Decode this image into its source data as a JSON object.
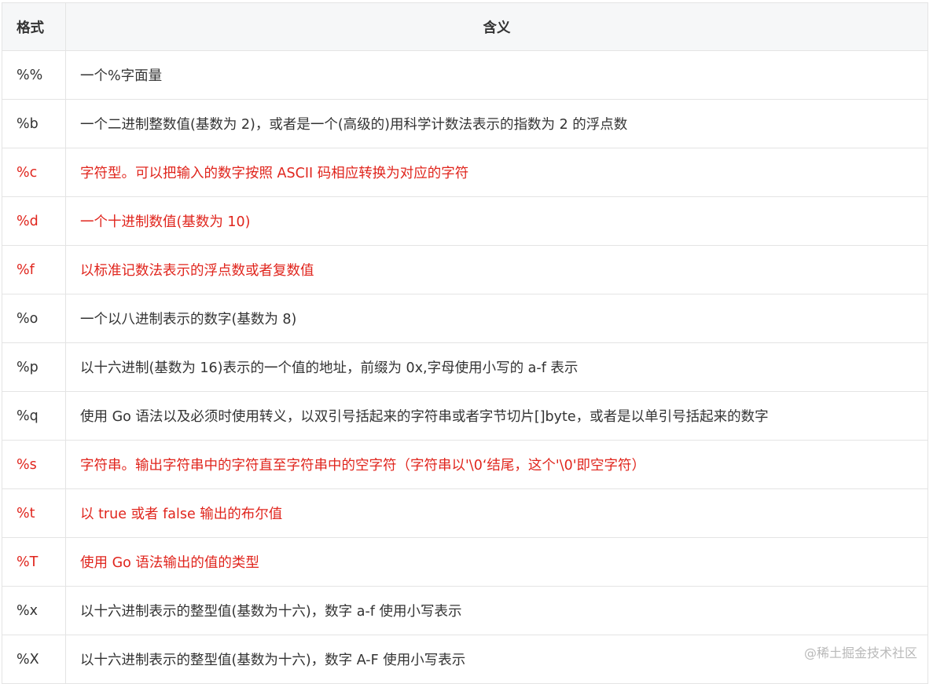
{
  "header": {
    "format": "格式",
    "meaning": "含义"
  },
  "accent_color": "#e0251d",
  "rows": [
    {
      "format": "%%",
      "meaning": "一个%字面量",
      "highlight": false
    },
    {
      "format": "%b",
      "meaning": "一个二进制整数值(基数为 2)，或者是一个(高级的)用科学计数法表示的指数为 2 的浮点数",
      "highlight": false
    },
    {
      "format": "%c",
      "meaning": "字符型。可以把输入的数字按照 ASCII 码相应转换为对应的字符",
      "highlight": true
    },
    {
      "format": "%d",
      "meaning": "一个十进制数值(基数为 10)",
      "highlight": true
    },
    {
      "format": "%f",
      "meaning": "以标准记数法表示的浮点数或者复数值",
      "highlight": true
    },
    {
      "format": "%o",
      "meaning": "一个以八进制表示的数字(基数为 8)",
      "highlight": false
    },
    {
      "format": "%p",
      "meaning": "以十六进制(基数为 16)表示的一个值的地址，前缀为 0x,字母使用小写的 a-f 表示",
      "highlight": false
    },
    {
      "format": "%q",
      "meaning": "使用 Go 语法以及必须时使用转义，以双引号括起来的字符串或者字节切片[]byte，或者是以单引号括起来的数字",
      "highlight": false
    },
    {
      "format": "%s",
      "meaning": "字符串。输出字符串中的字符直至字符串中的空字符（字符串以'\\0‘结尾，这个'\\0'即空字符）",
      "highlight": true
    },
    {
      "format": "%t",
      "meaning": "以 true 或者 false 输出的布尔值",
      "highlight": true
    },
    {
      "format": "%T",
      "meaning": "使用 Go 语法输出的值的类型",
      "highlight": true
    },
    {
      "format": "%x",
      "meaning": "以十六进制表示的整型值(基数为十六)，数字 a-f 使用小写表示",
      "highlight": false
    },
    {
      "format": "%X",
      "meaning": "以十六进制表示的整型值(基数为十六)，数字 A-F 使用小写表示",
      "highlight": false
    }
  ],
  "watermark": "@稀土掘金技术社区"
}
